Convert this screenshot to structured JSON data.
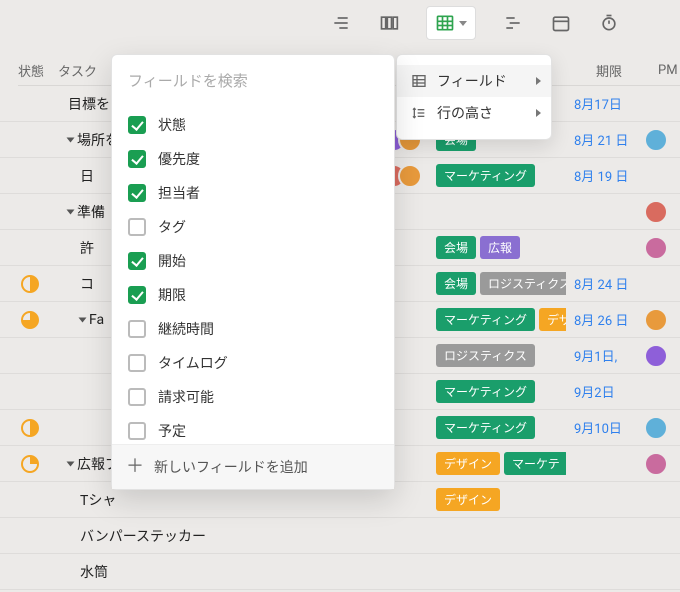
{
  "toolbar": {
    "active": "table"
  },
  "headers": {
    "status": "状態",
    "task": "タスク",
    "deadline": "期限",
    "pm": "PM"
  },
  "menu": {
    "fields": "フィールド",
    "row_height": "行の高さ"
  },
  "fieldPicker": {
    "placeholder": "フィールドを検索",
    "items": [
      {
        "label": "状態",
        "checked": true
      },
      {
        "label": "優先度",
        "checked": true
      },
      {
        "label": "担当者",
        "checked": true
      },
      {
        "label": "タグ",
        "checked": false
      },
      {
        "label": "開始",
        "checked": true
      },
      {
        "label": "期限",
        "checked": true
      },
      {
        "label": "継続時間",
        "checked": false
      },
      {
        "label": "タイムログ",
        "checked": false
      },
      {
        "label": "請求可能",
        "checked": false
      },
      {
        "label": "予定",
        "checked": false
      }
    ],
    "add": "新しいフィールドを追加"
  },
  "rows": [
    {
      "indent": 1,
      "tri": false,
      "status": null,
      "task": "目標を",
      "tags": [],
      "deadline": "8月17日",
      "pm": null
    },
    {
      "indent": 1,
      "tri": true,
      "status": null,
      "task": "場所を",
      "avatars": [
        "a",
        "b"
      ],
      "tags": [
        {
          "t": "会場",
          "c": "green"
        }
      ],
      "deadline": "8月 21 日",
      "pm": "c"
    },
    {
      "indent": 2,
      "tri": false,
      "status": null,
      "task": "日",
      "avatars": [
        "d",
        "b"
      ],
      "tags": [
        {
          "t": "マーケティング",
          "c": "green"
        }
      ],
      "deadline": "8月 19 日",
      "pm": null
    },
    {
      "indent": 1,
      "tri": true,
      "status": null,
      "task": "準備",
      "tags": [],
      "deadline": "",
      "pm": "d"
    },
    {
      "indent": 2,
      "tri": false,
      "status": null,
      "task": "許",
      "tags": [
        {
          "t": "会場",
          "c": "green"
        },
        {
          "t": "広報",
          "c": "purple"
        }
      ],
      "deadline": "",
      "pm": "f"
    },
    {
      "indent": 2,
      "tri": false,
      "status": "half",
      "task": "コ",
      "tags": [
        {
          "t": "会場",
          "c": "green"
        },
        {
          "t": "ロジスティクス",
          "c": "grey"
        }
      ],
      "deadline": "8月 24 日",
      "pm": null
    },
    {
      "indent": 2,
      "tri": true,
      "status": "34",
      "task": "Fa",
      "tags": [
        {
          "t": "マーケティング",
          "c": "green"
        },
        {
          "t": "デザ",
          "c": "orange"
        }
      ],
      "deadline": "8月 26 日",
      "pm": "b"
    },
    {
      "indent": 3,
      "tri": false,
      "status": null,
      "task": "",
      "tags": [
        {
          "t": "ロジスティクス",
          "c": "grey"
        }
      ],
      "deadline": "9月1日, ",
      "pm": "a"
    },
    {
      "indent": 3,
      "tri": false,
      "status": null,
      "task": "",
      "tags": [
        {
          "t": "マーケティング",
          "c": "green"
        }
      ],
      "deadline": "9月2日",
      "pm": null
    },
    {
      "indent": 3,
      "tri": false,
      "status": "half",
      "task": "",
      "tags": [
        {
          "t": "マーケティング",
          "c": "green"
        }
      ],
      "deadline": "9月10日",
      "pm": "c"
    },
    {
      "indent": 1,
      "tri": true,
      "status": "14",
      "task": "広報ブ",
      "tags": [
        {
          "t": "デザイン",
          "c": "orange"
        },
        {
          "t": "マーケテ",
          "c": "green"
        }
      ],
      "deadline": "",
      "pm": "f"
    },
    {
      "indent": 2,
      "tri": false,
      "status": null,
      "task": "Tシャ",
      "tags": [
        {
          "t": "デザイン",
          "c": "orange"
        }
      ],
      "deadline": "",
      "pm": null
    },
    {
      "indent": 2,
      "tri": false,
      "status": null,
      "task": "バンパーステッカー",
      "tags": [],
      "deadline": "",
      "pm": null
    },
    {
      "indent": 2,
      "tri": false,
      "status": null,
      "task": "水筒",
      "tags": [],
      "deadline": "",
      "pm": null
    }
  ]
}
